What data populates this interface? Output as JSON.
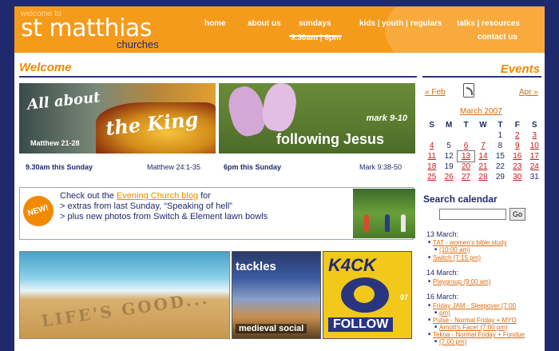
{
  "header": {
    "welcome_to": "welcome to",
    "title": "st matthias",
    "subtitle": "churches",
    "nav": {
      "home": "home",
      "about": "about us",
      "sundays": "sundays",
      "sunday_times": "9.30am | 6pm",
      "kids": "kids |",
      "youth": "youth |",
      "regulars": "regulars",
      "talks": "talks | resources",
      "contact": "contact us"
    },
    "colors": {
      "orange": "#f59b1c",
      "navy": "#1f2a6e"
    }
  },
  "welcome": {
    "heading": "Welcome",
    "banner1": {
      "line1": "All about",
      "line2": "the King",
      "ref": "Matthew 21-28"
    },
    "banner2": {
      "ref": "mark 9-10",
      "title": "following Jesus"
    },
    "caption1_left": "9.30am this Sunday",
    "caption1_right": "Matthew 24:1-35",
    "caption2_left": "6pm this Sunday",
    "caption2_right": "Mark 9:38-50",
    "news": {
      "badge": "NEW!",
      "line1_pre": "Check out the ",
      "line1_link": "Evening Church blog",
      "line1_post": " for",
      "line2": "> extras from last Sunday, “Speaking of hell”",
      "line3": "> plus new photos from Switch & Element lawn bowls"
    },
    "promo_beach": "LIFE'S GOOD...",
    "promo_tackles_title": "tackles",
    "promo_tackles_sub": "medieval social",
    "promo_kick_title": "K4CK",
    "promo_kick_num": "07",
    "promo_kick_sub": "FOLLOW"
  },
  "events": {
    "heading": "Events",
    "prev": "« Feb",
    "next": "Apr »",
    "month": "March 2007",
    "weekdays": [
      "S",
      "M",
      "T",
      "W",
      "T",
      "F",
      "S"
    ],
    "weeks": [
      [
        "",
        "",
        "",
        "",
        "1",
        "2",
        "3"
      ],
      [
        "4",
        "5",
        "6",
        "7",
        "8",
        "9",
        "10"
      ],
      [
        "11",
        "12",
        "13",
        "14",
        "15",
        "16",
        "17"
      ],
      [
        "18",
        "19",
        "20",
        "21",
        "22",
        "23",
        "24"
      ],
      [
        "25",
        "26",
        "27",
        "28",
        "29",
        "30",
        "31"
      ]
    ],
    "search_heading": "Search calendar",
    "search_button": "Go",
    "days": [
      {
        "date": "13 March:",
        "items": [
          "TAT - women's bible study",
          "(10:00 am)",
          "Switch (7:15 pm)"
        ]
      },
      {
        "date": "14 March:",
        "items": [
          "Playgroup (9:00 am)"
        ]
      },
      {
        "date": "16 March:",
        "items": [
          "Friday JAM - Sleepover (7:00",
          "pm)",
          "Pulse - Normal Friday + MYO",
          "Arnott's Face! (7:00 pm)",
          "Tekoa - Normal Friday + Fondue",
          "(7:00 pm)"
        ]
      }
    ]
  }
}
